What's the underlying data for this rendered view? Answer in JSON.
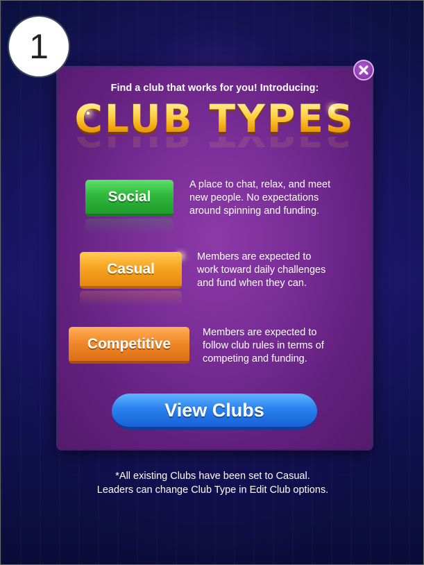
{
  "step_badge": "1",
  "modal": {
    "intro": "Find a club that works for you! Introducing:",
    "title": "CLUB TYPES",
    "close_icon": "close-icon",
    "club_types": [
      {
        "label": "Social",
        "color": "#2fb93c",
        "description": [
          "A place to chat, relax, and meet",
          "new people. No expectations",
          "around spinning and funding."
        ]
      },
      {
        "label": "Casual",
        "color": "#f7a423",
        "description": [
          "Members are expected to",
          "work toward daily challenges",
          "and fund when they can."
        ]
      },
      {
        "label": "Competitive",
        "color": "#f18a2a",
        "description": [
          "Members are expected to",
          "follow club rules in terms of",
          "competing and funding."
        ]
      }
    ],
    "view_button": "View Clubs",
    "view_button_color": "#2a82ef"
  },
  "footnote": [
    "*All existing Clubs have been set to Casual.",
    "Leaders can change Club Type in Edit Club options."
  ]
}
